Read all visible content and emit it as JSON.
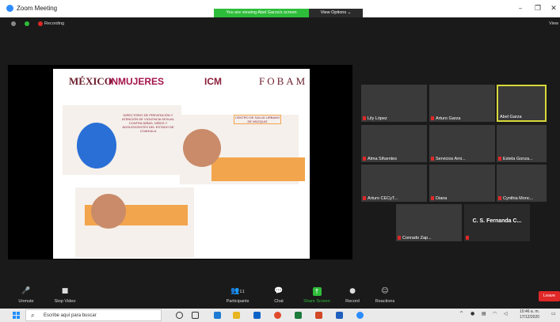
{
  "window": {
    "title": "Zoom Meeting",
    "banner": "You are viewing Abel Garza's screen",
    "view_options": "View Options ⌄",
    "minimize": "–",
    "maximize": "❐",
    "close": "✕"
  },
  "status": {
    "recording_label": "Recording",
    "gallery_label": "View"
  },
  "slide": {
    "logo_mexico": "MÉXICO",
    "logo_inmujeres": "INMUJERES",
    "logo_icm": "ICM",
    "logo_fobam": "FOBAM",
    "heading": "DIRECTORIO DE PREVENCIÓN Y ATENCIÓN DE VIOLENCIA SEXUAL CONTRA NIÑAS, NIÑOS Y ADOLESCENTES DEL ESTADO DE COAHUILA",
    "box_title": "CENTRO DE SALUD URBANO DE MÚZQUIZ"
  },
  "participants": [
    {
      "name": "Lily López"
    },
    {
      "name": "Arturo Garza"
    },
    {
      "name": "Abel Garza",
      "active": true
    },
    {
      "name": "Alma Sifuentes"
    },
    {
      "name": "Servicios Ami..."
    },
    {
      "name": "Estela Gonza..."
    },
    {
      "name": "Arturo CECyT..."
    },
    {
      "name": "Diana"
    },
    {
      "name": "Cynthia Monc..."
    },
    {
      "name": "Conrado Zap..."
    },
    {
      "name": "",
      "text_tile": "C. S. Fernanda C..."
    }
  ],
  "controls": {
    "unmute": "Unmute",
    "stop_video": "Stop Video",
    "participants": "Participants",
    "participants_count": "11",
    "chat": "Chat",
    "share_screen": "Share Screen",
    "record": "Record",
    "reactions": "Reactions",
    "leave": "Leave"
  },
  "taskbar": {
    "search_placeholder": "Escribe aquí para buscar",
    "time": "10:46 a. m.",
    "date": "17/12/2020"
  },
  "colors": {
    "accent_green": "#2ebd3a",
    "leave_red": "#e02828",
    "zoom_blue": "#2d8cff",
    "active_speaker": "#d8d83b"
  }
}
